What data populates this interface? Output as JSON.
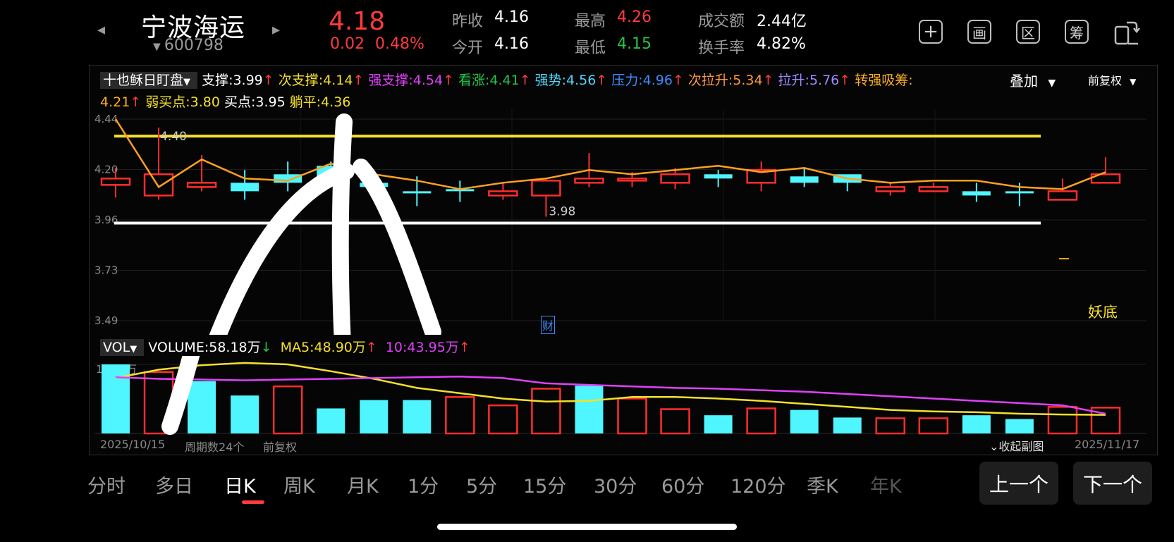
{
  "header": {
    "prev_arrow": "◂",
    "next_arrow": "▸",
    "stock_name": "宁波海运",
    "stock_code": "600798",
    "price": "4.18",
    "change": "0.02",
    "change_pct": "0.48%",
    "stats": {
      "prev_close_label": "昨收",
      "prev_close": "4.16",
      "open_label": "今开",
      "open": "4.16",
      "high_label": "最高",
      "high": "4.26",
      "low_label": "最低",
      "low": "4.15",
      "amount_label": "成交额",
      "amount": "2.44亿",
      "turnover_label": "换手率",
      "turnover": "4.82%"
    },
    "tools": {
      "add": "+",
      "draw": "画",
      "range": "区",
      "chip": "筹"
    }
  },
  "indicator": {
    "name": "十也稣日盯盘",
    "items": [
      {
        "label": "支撑:3.99",
        "arrow": "↑",
        "color": "#ffffff"
      },
      {
        "label": "次支撑:4.14",
        "arrow": "↑",
        "color": "#f5e02a"
      },
      {
        "label": "强支撑:4.54",
        "arrow": "↑",
        "color": "#e040fb"
      },
      {
        "label": "看涨:4.41",
        "arrow": "↑",
        "color": "#27c24c"
      },
      {
        "label": "强势:4.56",
        "arrow": "↑",
        "color": "#4fd8ff"
      },
      {
        "label": "压力:4.96",
        "arrow": "↑",
        "color": "#3f8cff"
      },
      {
        "label": "次拉升:5.34",
        "arrow": "↑",
        "color": "#ff9a3c"
      },
      {
        "label": "拉升:5.76",
        "arrow": "↑",
        "color": "#9a8cff"
      },
      {
        "label": "转强吸筹:",
        "arrow": "",
        "color": "#ffb020"
      }
    ],
    "items_line2": [
      {
        "label": "4.21",
        "arrow": "↑",
        "color": "#ffb020"
      },
      {
        "label": "弱买点:3.80",
        "arrow": "",
        "color": "#f5e02a"
      },
      {
        "label": "买点:3.95",
        "arrow": "",
        "color": "#ffffff"
      },
      {
        "label": "躺平:4.36",
        "arrow": "",
        "color": "#f5e02a"
      }
    ],
    "overlay_label": "叠加",
    "adjust_label": "前复权"
  },
  "price_chart": {
    "y_ticks": [
      "4.44",
      "4.20",
      "3.96",
      "3.73",
      "3.49"
    ],
    "max_label": "4.40",
    "min_label": "3.98",
    "yaodi_label": "妖底",
    "cai_label": "财"
  },
  "volume": {
    "name": "VOL",
    "volume_label": "VOLUME:58.18万",
    "volume_arrow": "↓",
    "ma5_label": "MA5:48.90万",
    "ma5_arrow": "↑",
    "ma10_label": "10:43.95万",
    "ma10_arrow": "↑",
    "max_tick": "182.0万",
    "start_date": "2025/10/15",
    "period_count": "周期数24个",
    "adjust": "前复权",
    "collapse": "收起副图",
    "end_date": "2025/11/17"
  },
  "chart_data": [
    {
      "type": "candlestick",
      "x": [
        "2025/10/15",
        "",
        "",
        "",
        "",
        "",
        "",
        "",
        "",
        "",
        "",
        "",
        "",
        "",
        "",
        "",
        "",
        "",
        "",
        "",
        "",
        "",
        "",
        "2025/11/17"
      ],
      "open": [
        4.13,
        4.08,
        4.12,
        4.14,
        4.18,
        4.22,
        4.14,
        4.1,
        4.11,
        4.08,
        4.08,
        4.14,
        4.15,
        4.14,
        4.18,
        4.14,
        4.17,
        4.18,
        4.1,
        4.1,
        4.1,
        4.1,
        4.06,
        4.14
      ],
      "close": [
        4.16,
        4.18,
        4.14,
        4.1,
        4.14,
        4.16,
        4.12,
        4.09,
        4.1,
        4.1,
        4.15,
        4.16,
        4.16,
        4.18,
        4.16,
        4.2,
        4.14,
        4.14,
        4.12,
        4.12,
        4.08,
        4.09,
        4.1,
        4.18
      ],
      "high": [
        4.21,
        4.4,
        4.27,
        4.2,
        4.24,
        4.24,
        4.2,
        4.17,
        4.15,
        4.14,
        4.16,
        4.28,
        4.19,
        4.21,
        4.2,
        4.24,
        4.21,
        4.16,
        4.14,
        4.14,
        4.14,
        4.14,
        4.16,
        4.26
      ],
      "low": [
        4.07,
        4.06,
        4.1,
        4.06,
        4.1,
        4.14,
        4.1,
        4.03,
        4.05,
        4.06,
        3.98,
        4.12,
        4.12,
        4.11,
        4.12,
        4.1,
        4.12,
        4.1,
        4.08,
        4.1,
        4.05,
        4.03,
        4.07,
        4.15
      ],
      "ma_line": [
        4.44,
        4.12,
        4.25,
        4.16,
        4.15,
        4.23,
        4.18,
        4.15,
        4.11,
        4.14,
        4.16,
        4.2,
        4.18,
        4.2,
        4.22,
        4.19,
        4.21,
        4.16,
        4.14,
        4.15,
        4.15,
        4.12,
        4.11,
        4.19
      ],
      "ylim": [
        3.49,
        4.44
      ],
      "horizontal_lines": {
        "upper": 4.36,
        "lower": 3.95
      }
    },
    {
      "type": "bar",
      "x": [
        "2025/10/15",
        "",
        "",
        "",
        "",
        "",
        "",
        "",
        "",
        "",
        "",
        "",
        "",
        "",
        "",
        "",
        "",
        "",
        "",
        "",
        "",
        "",
        "",
        "2025/11/17"
      ],
      "values": [
        182,
        162,
        138,
        100,
        124,
        66,
        88,
        88,
        96,
        74,
        118,
        126,
        92,
        64,
        48,
        66,
        62,
        42,
        40,
        40,
        48,
        38,
        70,
        68
      ],
      "rising": [
        false,
        true,
        false,
        false,
        true,
        false,
        false,
        false,
        true,
        true,
        true,
        false,
        true,
        true,
        false,
        true,
        false,
        false,
        true,
        true,
        false,
        false,
        true,
        true
      ],
      "series": [
        {
          "name": "MA5",
          "values": [
            146,
            168,
            180,
            186,
            182,
            164,
            144,
            120,
            106,
            92,
            84,
            86,
            96,
            96,
            92,
            86,
            78,
            70,
            62,
            58,
            56,
            52,
            50,
            48.9
          ]
        },
        {
          "name": "10",
          "values": [
            148,
            144,
            142,
            140,
            142,
            144,
            146,
            148,
            150,
            146,
            132,
            128,
            124,
            120,
            118,
            114,
            110,
            104,
            98,
            92,
            86,
            80,
            74,
            52
          ]
        }
      ],
      "ylim": [
        0,
        182
      ]
    }
  ]
}
